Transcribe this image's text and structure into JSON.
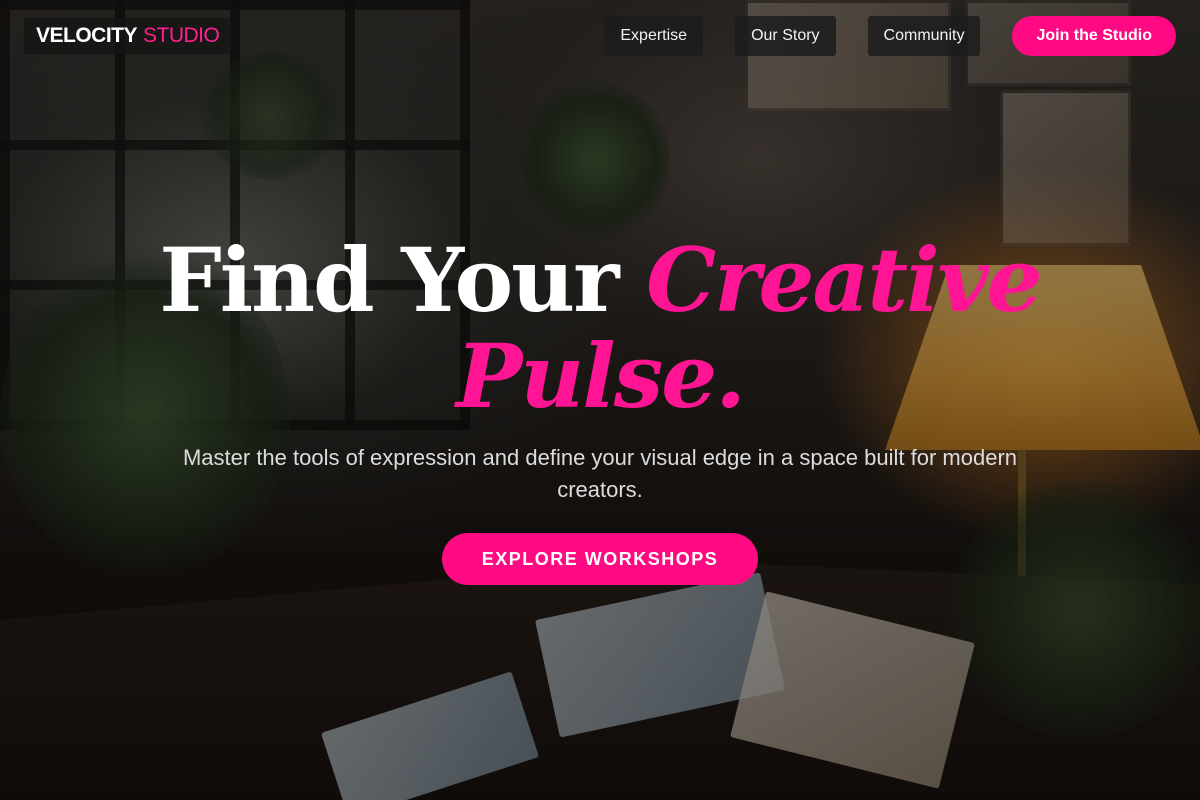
{
  "header": {
    "logo": {
      "primary": "VELOCITY",
      "accent": "STUDIO"
    },
    "nav": [
      {
        "label": "Expertise"
      },
      {
        "label": "Our Story"
      },
      {
        "label": "Community"
      }
    ],
    "cta_label": "Join the Studio"
  },
  "hero": {
    "title_plain": "Find Your",
    "title_accent_1": "Creative",
    "title_accent_2": "Pulse.",
    "subtitle": "Master the tools of expression and define your visual edge in a space built for modern creators.",
    "cta_label": "EXPLORE WORKSHOPS"
  },
  "colors": {
    "accent": "#ff0a83",
    "title_accent": "#ff1493",
    "nav_bg": "#1c1c1c",
    "text": "#ffffff"
  }
}
